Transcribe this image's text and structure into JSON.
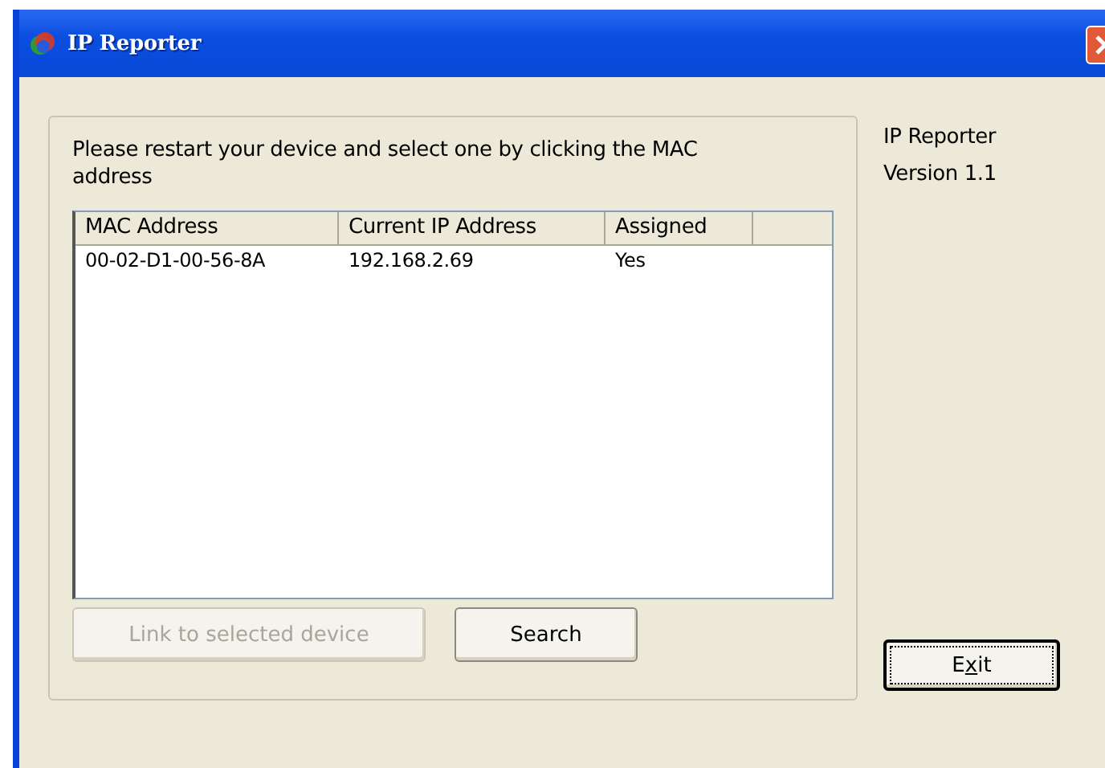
{
  "window": {
    "title": "IP Reporter"
  },
  "instructions": "Please restart your device and select one by clicking the MAC address",
  "table": {
    "columns": [
      "MAC Address",
      "Current IP Address",
      "Assigned"
    ],
    "rows": [
      {
        "cells": [
          "00-02-D1-00-56-8A",
          "192.168.2.69",
          "Yes"
        ],
        "selected": false
      }
    ]
  },
  "buttons": [
    {
      "label": "Link to selected device",
      "disabled": true
    },
    {
      "label": "Search",
      "disabled": false
    }
  ],
  "about": {
    "name": "IP Reporter",
    "version": "Version 1.1"
  },
  "exit_button": {
    "label_before_mnemonic": "E",
    "mnemonic": "x",
    "label_after_mnemonic": "it",
    "focused": true
  }
}
